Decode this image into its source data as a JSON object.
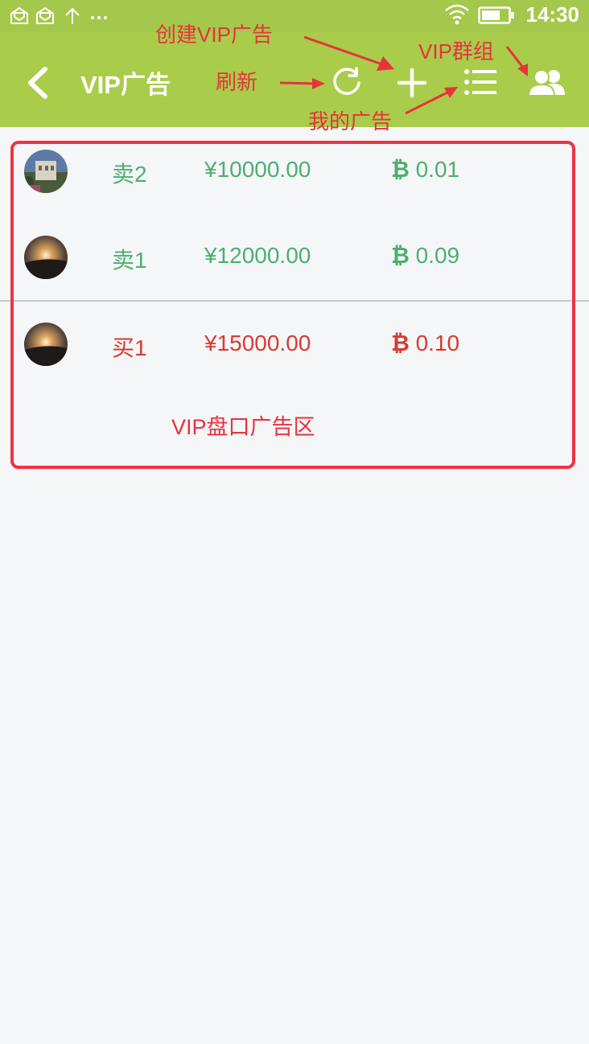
{
  "status_bar": {
    "time": "14:30",
    "left_icons": [
      "mail-icon",
      "mail-icon",
      "upload-icon",
      "more-icon"
    ],
    "right_icons": [
      "wifi-icon",
      "battery-icon"
    ]
  },
  "toolbar": {
    "title": "VIP广告",
    "buttons": [
      "back-icon",
      "refresh-icon",
      "plus-icon",
      "list-icon",
      "group-icon"
    ]
  },
  "annotations": {
    "refresh": "刷新",
    "create": "创建VIP广告",
    "my_ads": "我的广告",
    "vip_group": "VIP群组",
    "area": "VIP盘口广告区"
  },
  "ads": [
    {
      "label": "卖2",
      "price": "¥10000.00",
      "btc": "0.01",
      "side": "sell"
    },
    {
      "label": "卖1",
      "price": "¥12000.00",
      "btc": "0.09",
      "side": "sell"
    },
    {
      "label": "买1",
      "price": "¥15000.00",
      "btc": "0.10",
      "side": "buy"
    }
  ],
  "colors": {
    "toolbar": "#a9cc4a",
    "sell": "#4caf6e",
    "buy": "#d83a32",
    "annotation": "#e8323c"
  }
}
